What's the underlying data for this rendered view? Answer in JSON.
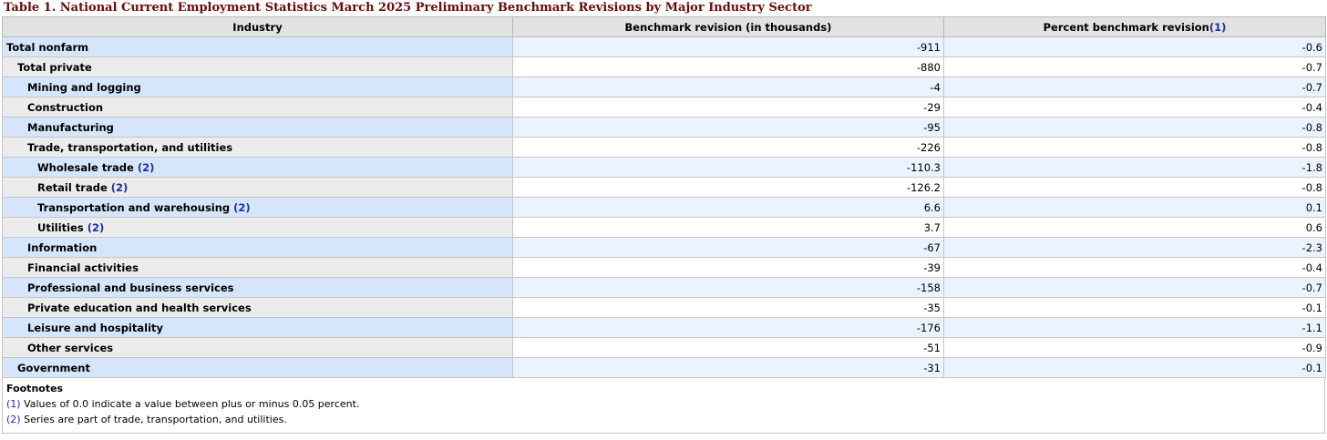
{
  "title": "Table 1. National Current Employment Statistics March 2025 Preliminary Benchmark Revisions by Major Industry Sector",
  "headers": {
    "industry": "Industry",
    "benchmark": "Benchmark revision (in thousands)",
    "percent": "Percent benchmark revision",
    "percent_ref": "(1)"
  },
  "rows": [
    {
      "name": "Total nonfarm",
      "ref": "",
      "benchmark": "-911",
      "percent": "-0.6"
    },
    {
      "name": "Total private",
      "ref": "",
      "benchmark": "-880",
      "percent": "-0.7"
    },
    {
      "name": "Mining and logging",
      "ref": "",
      "benchmark": "-4",
      "percent": "-0.7"
    },
    {
      "name": "Construction",
      "ref": "",
      "benchmark": "-29",
      "percent": "-0.4"
    },
    {
      "name": "Manufacturing",
      "ref": "",
      "benchmark": "-95",
      "percent": "-0.8"
    },
    {
      "name": "Trade, transportation, and utilities",
      "ref": "",
      "benchmark": "-226",
      "percent": "-0.8"
    },
    {
      "name": "Wholesale trade",
      "ref": "(2)",
      "benchmark": "-110.3",
      "percent": "-1.8"
    },
    {
      "name": "Retail trade",
      "ref": "(2)",
      "benchmark": "-126.2",
      "percent": "-0.8"
    },
    {
      "name": "Transportation and warehousing",
      "ref": "(2)",
      "benchmark": "6.6",
      "percent": "0.1"
    },
    {
      "name": "Utilities",
      "ref": "(2)",
      "benchmark": "3.7",
      "percent": "0.6"
    },
    {
      "name": "Information",
      "ref": "",
      "benchmark": "-67",
      "percent": "-2.3"
    },
    {
      "name": "Financial activities",
      "ref": "",
      "benchmark": "-39",
      "percent": "-0.4"
    },
    {
      "name": "Professional and business services",
      "ref": "",
      "benchmark": "-158",
      "percent": "-0.7"
    },
    {
      "name": "Private education and health services",
      "ref": "",
      "benchmark": "-35",
      "percent": "-0.1"
    },
    {
      "name": "Leisure and hospitality",
      "ref": "",
      "benchmark": "-176",
      "percent": "-1.1"
    },
    {
      "name": "Other services",
      "ref": "",
      "benchmark": "-51",
      "percent": "-0.9"
    },
    {
      "name": "Government",
      "ref": "",
      "benchmark": "-31",
      "percent": "-0.1"
    }
  ],
  "footnotes": {
    "title": "Footnotes",
    "items": [
      {
        "ref": "(1)",
        "text": "Values of 0.0 indicate a value between plus or minus 0.05 percent."
      },
      {
        "ref": "(2)",
        "text": "Series are part of trade, transportation, and utilities."
      }
    ]
  }
}
